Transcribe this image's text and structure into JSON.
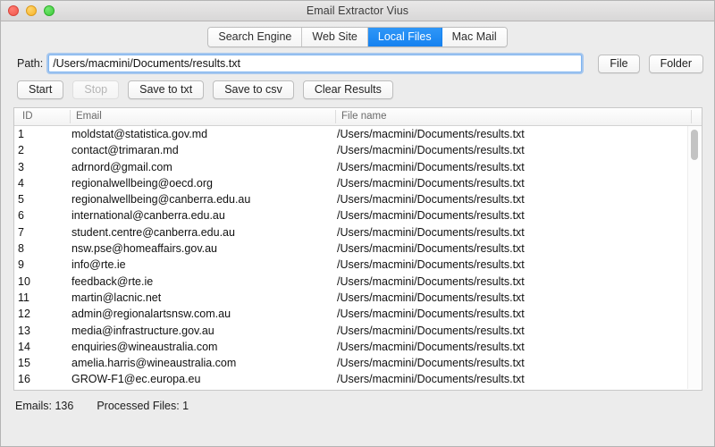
{
  "window": {
    "title": "Email Extractor Vius",
    "controls": [
      {
        "name": "close-button",
        "color": "#f0564c"
      },
      {
        "name": "minimize-button",
        "color": "#f6b429"
      },
      {
        "name": "maximize-button",
        "color": "#3ec93a"
      }
    ]
  },
  "tabs": {
    "items": [
      {
        "label": "Search Engine",
        "active": false
      },
      {
        "label": "Web Site",
        "active": false
      },
      {
        "label": "Local Files",
        "active": true
      },
      {
        "label": "Mac Mail",
        "active": false
      }
    ],
    "active_color": "#1581f0"
  },
  "path_row": {
    "label": "Path:",
    "value": "/Users/macmini/Documents/results.txt",
    "placeholder": "",
    "focus_color": "#7eb4f0",
    "file_button": "File",
    "folder_button": "Folder"
  },
  "actions": {
    "start": "Start",
    "stop": "Stop",
    "stop_disabled": true,
    "save_txt": "Save to txt",
    "save_csv": "Save to csv",
    "clear": "Clear Results"
  },
  "table": {
    "columns": [
      "ID",
      "Email",
      "File name"
    ],
    "rows": [
      {
        "id": "1",
        "email": "moldstat@statistica.gov.md",
        "file": "/Users/macmini/Documents/results.txt"
      },
      {
        "id": "2",
        "email": "contact@trimaran.md",
        "file": "/Users/macmini/Documents/results.txt"
      },
      {
        "id": "3",
        "email": "adrnord@gmail.com",
        "file": "/Users/macmini/Documents/results.txt"
      },
      {
        "id": "4",
        "email": "regionalwellbeing@oecd.org",
        "file": "/Users/macmini/Documents/results.txt"
      },
      {
        "id": "5",
        "email": "regionalwellbeing@canberra.edu.au",
        "file": "/Users/macmini/Documents/results.txt"
      },
      {
        "id": "6",
        "email": "international@canberra.edu.au",
        "file": "/Users/macmini/Documents/results.txt"
      },
      {
        "id": "7",
        "email": "student.centre@canberra.edu.au",
        "file": "/Users/macmini/Documents/results.txt"
      },
      {
        "id": "8",
        "email": "nsw.pse@homeaffairs.gov.au",
        "file": "/Users/macmini/Documents/results.txt"
      },
      {
        "id": "9",
        "email": "info@rte.ie",
        "file": "/Users/macmini/Documents/results.txt"
      },
      {
        "id": "10",
        "email": "feedback@rte.ie",
        "file": "/Users/macmini/Documents/results.txt"
      },
      {
        "id": "11",
        "email": "martin@lacnic.net",
        "file": "/Users/macmini/Documents/results.txt"
      },
      {
        "id": "12",
        "email": "admin@regionalartsnsw.com.au",
        "file": "/Users/macmini/Documents/results.txt"
      },
      {
        "id": "13",
        "email": "media@infrastructure.gov.au",
        "file": "/Users/macmini/Documents/results.txt"
      },
      {
        "id": "14",
        "email": "enquiries@wineaustralia.com",
        "file": "/Users/macmini/Documents/results.txt"
      },
      {
        "id": "15",
        "email": "amelia.harris@wineaustralia.com",
        "file": "/Users/macmini/Documents/results.txt"
      },
      {
        "id": "16",
        "email": "GROW-F1@ec.europa.eu",
        "file": "/Users/macmini/Documents/results.txt"
      }
    ]
  },
  "status": {
    "emails": "Emails: 136",
    "processed_files": "Processed Files: 1"
  }
}
